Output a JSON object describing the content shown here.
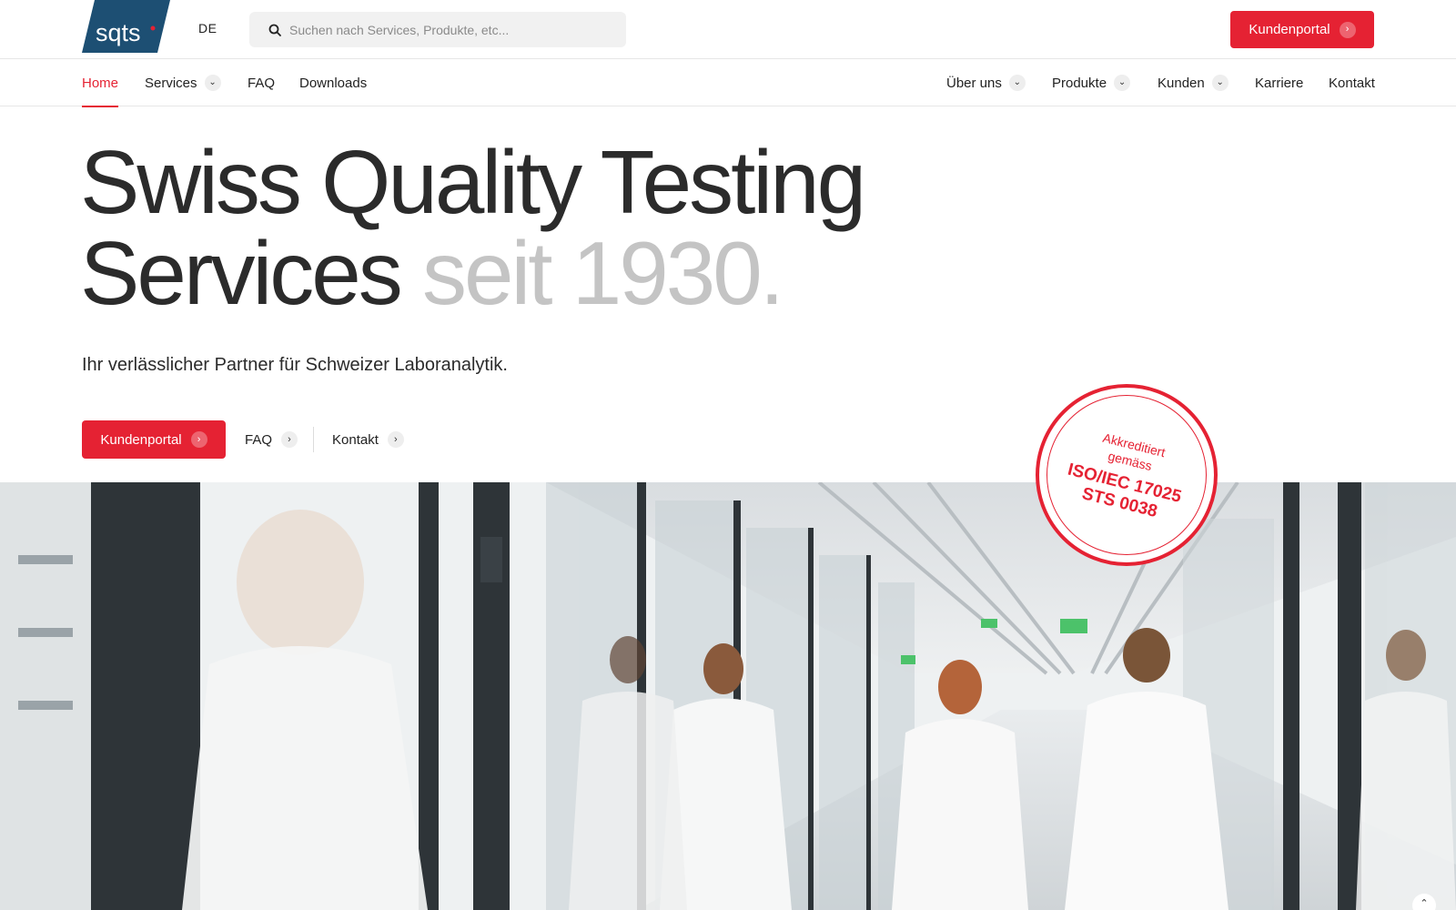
{
  "header": {
    "logo_text": "sqts",
    "language": "DE",
    "search": {
      "placeholder": "Suchen nach Services, Produkte, etc..."
    },
    "portal_button": "Kundenportal"
  },
  "nav": {
    "left": [
      {
        "label": "Home",
        "active": true,
        "dropdown": false
      },
      {
        "label": "Services",
        "active": false,
        "dropdown": true
      },
      {
        "label": "FAQ",
        "active": false,
        "dropdown": false
      },
      {
        "label": "Downloads",
        "active": false,
        "dropdown": false
      }
    ],
    "right": [
      {
        "label": "Über uns",
        "dropdown": true
      },
      {
        "label": "Produkte",
        "dropdown": true
      },
      {
        "label": "Kunden",
        "dropdown": true
      },
      {
        "label": "Karriere",
        "dropdown": false
      },
      {
        "label": "Kontakt",
        "dropdown": false
      }
    ]
  },
  "hero": {
    "headline_line1": "Swiss Quality Testing",
    "headline_line2_dark": "Services",
    "headline_line2_light": "seit 1930.",
    "subline": "Ihr verlässlicher Partner für Schweizer Laboranalytik.",
    "cta_primary": "Kundenportal",
    "cta_faq": "FAQ",
    "cta_contact": "Kontakt"
  },
  "badge": {
    "line1": "Akkreditiert",
    "line2": "gemäss",
    "line3": "ISO/IEC 17025",
    "line4": "STS 0038"
  },
  "colors": {
    "accent": "#e52233",
    "logo_blue": "#1d4f73",
    "text_dark": "#2b2b2b",
    "text_light": "#c4c4c4"
  },
  "icons": {
    "search": "search-icon",
    "chevron_right": "chevron-right-icon",
    "chevron_down": "chevron-down-icon",
    "chevron_up": "chevron-up-icon"
  }
}
